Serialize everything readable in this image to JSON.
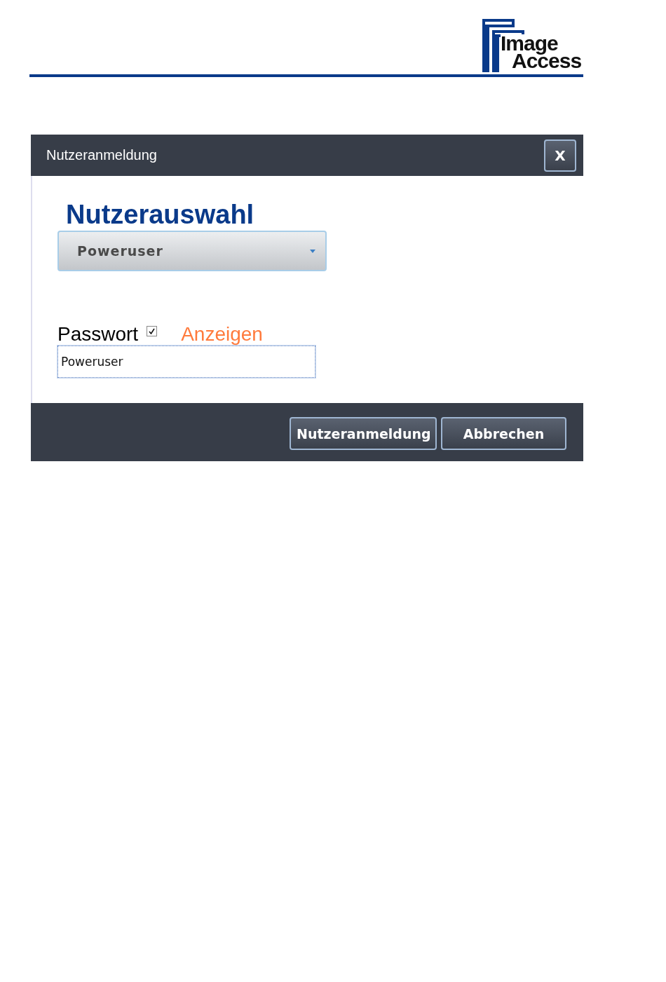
{
  "logo": {
    "line_1": "Image",
    "line_2": "Access"
  },
  "dialog": {
    "title": "Nutzeranmeldung",
    "close": "X",
    "heading": "Nutzerauswahl",
    "user_select": {
      "value": "Poweruser"
    },
    "password": {
      "label": "Passwort",
      "show_checked": true,
      "show_label": "Anzeigen",
      "value": "Poweruser"
    },
    "buttons": [
      {
        "label": "Nutzeranmeldung"
      },
      {
        "label": "Abbrechen"
      }
    ]
  }
}
